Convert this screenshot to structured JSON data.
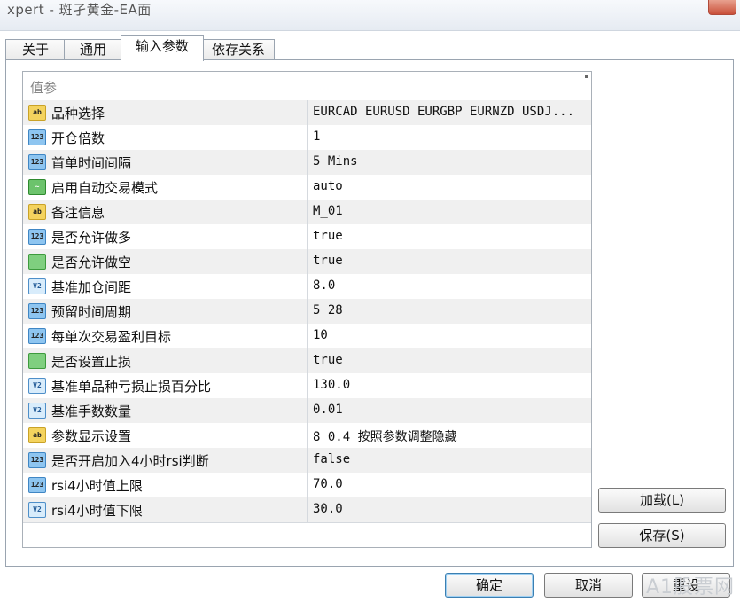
{
  "window": {
    "title": "xpert - 斑孑黄金-EA面"
  },
  "tabs": [
    {
      "label": "关于"
    },
    {
      "label": "通用"
    },
    {
      "label": "输入参数"
    },
    {
      "label": "依存关系"
    }
  ],
  "grid": {
    "header": "值参",
    "rows": [
      {
        "icon": "ab",
        "name": "品种选择",
        "value": "EURCAD  EURUSD EURGBP EURNZD  USDJ..."
      },
      {
        "icon": "123",
        "name": "开仓倍数",
        "value": "1"
      },
      {
        "icon": "123",
        "name": "首单时间间隔",
        "value": "5 Mins"
      },
      {
        "icon": "line",
        "name": "启用自动交易模式",
        "value": "auto"
      },
      {
        "icon": "ab",
        "name": "备注信息",
        "value": "M_01"
      },
      {
        "icon": "123",
        "name": "是否允许做多",
        "value": "true"
      },
      {
        "icon": "grn",
        "name": "是否允许做空",
        "value": "true"
      },
      {
        "icon": "v2",
        "name": "基准加仓间距",
        "value": "8.0"
      },
      {
        "icon": "123",
        "name": "预留时间周期",
        "value": "5 28"
      },
      {
        "icon": "123",
        "name": "每单次交易盈利目标",
        "value": "10"
      },
      {
        "icon": "grn",
        "name": "是否设置止损",
        "value": "true"
      },
      {
        "icon": "v2",
        "name": "基准单品种亏损止损百分比",
        "value": "130.0"
      },
      {
        "icon": "v2",
        "name": "基准手数数量",
        "value": "0.01"
      },
      {
        "icon": "ab",
        "name": "参数显示设置",
        "value": "8 0.4 按照参数调整隐藏"
      },
      {
        "icon": "123",
        "name": "是否开启加入4小时rsi判断",
        "value": "false"
      },
      {
        "icon": "123",
        "name": "rsi4小时值上限",
        "value": "70.0"
      },
      {
        "icon": "v2",
        "name": "rsi4小时值下限",
        "value": "30.0"
      }
    ]
  },
  "buttons": {
    "load": "加载(L)",
    "save": "保存(S)",
    "ok": "确定",
    "cancel": "取消",
    "reset": "重设"
  },
  "watermark": "A1股票网"
}
